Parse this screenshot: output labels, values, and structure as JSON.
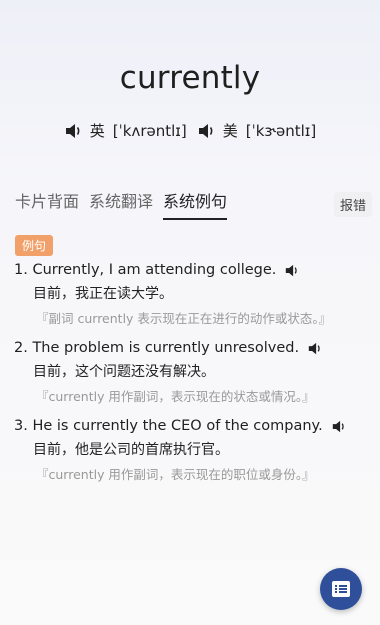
{
  "word": "currently",
  "pronunciations": [
    {
      "region": "英",
      "ipa": "[ˈkʌrəntlɪ]"
    },
    {
      "region": "美",
      "ipa": "[ˈkɝəntlɪ]"
    }
  ],
  "tabs": [
    {
      "label": "卡片背面",
      "active": false
    },
    {
      "label": "系统翻译",
      "active": false
    },
    {
      "label": "系统例句",
      "active": true
    }
  ],
  "report_label": "报错",
  "section_badge": "例句",
  "examples": [
    {
      "number": "1.",
      "en": "Currently, I am attending college.",
      "zh": "目前，我正在读大学。",
      "note": "『副词 currently 表示现在正在进行的动作或状态。』"
    },
    {
      "number": "2.",
      "en": "The problem is currently unresolved.",
      "zh": "目前，这个问题还没有解决。",
      "note": "『currently 用作副词，表示现在的状态或情况。』"
    },
    {
      "number": "3.",
      "en": "He is currently the CEO of the company.",
      "zh": "目前，他是公司的首席执行官。",
      "note": "『currently 用作副词，表示现在的职位或身份。』"
    }
  ],
  "fab_icon": "notes-list-icon",
  "colors": {
    "accent": "#2f4f9b",
    "badge": "#f2a06a"
  }
}
